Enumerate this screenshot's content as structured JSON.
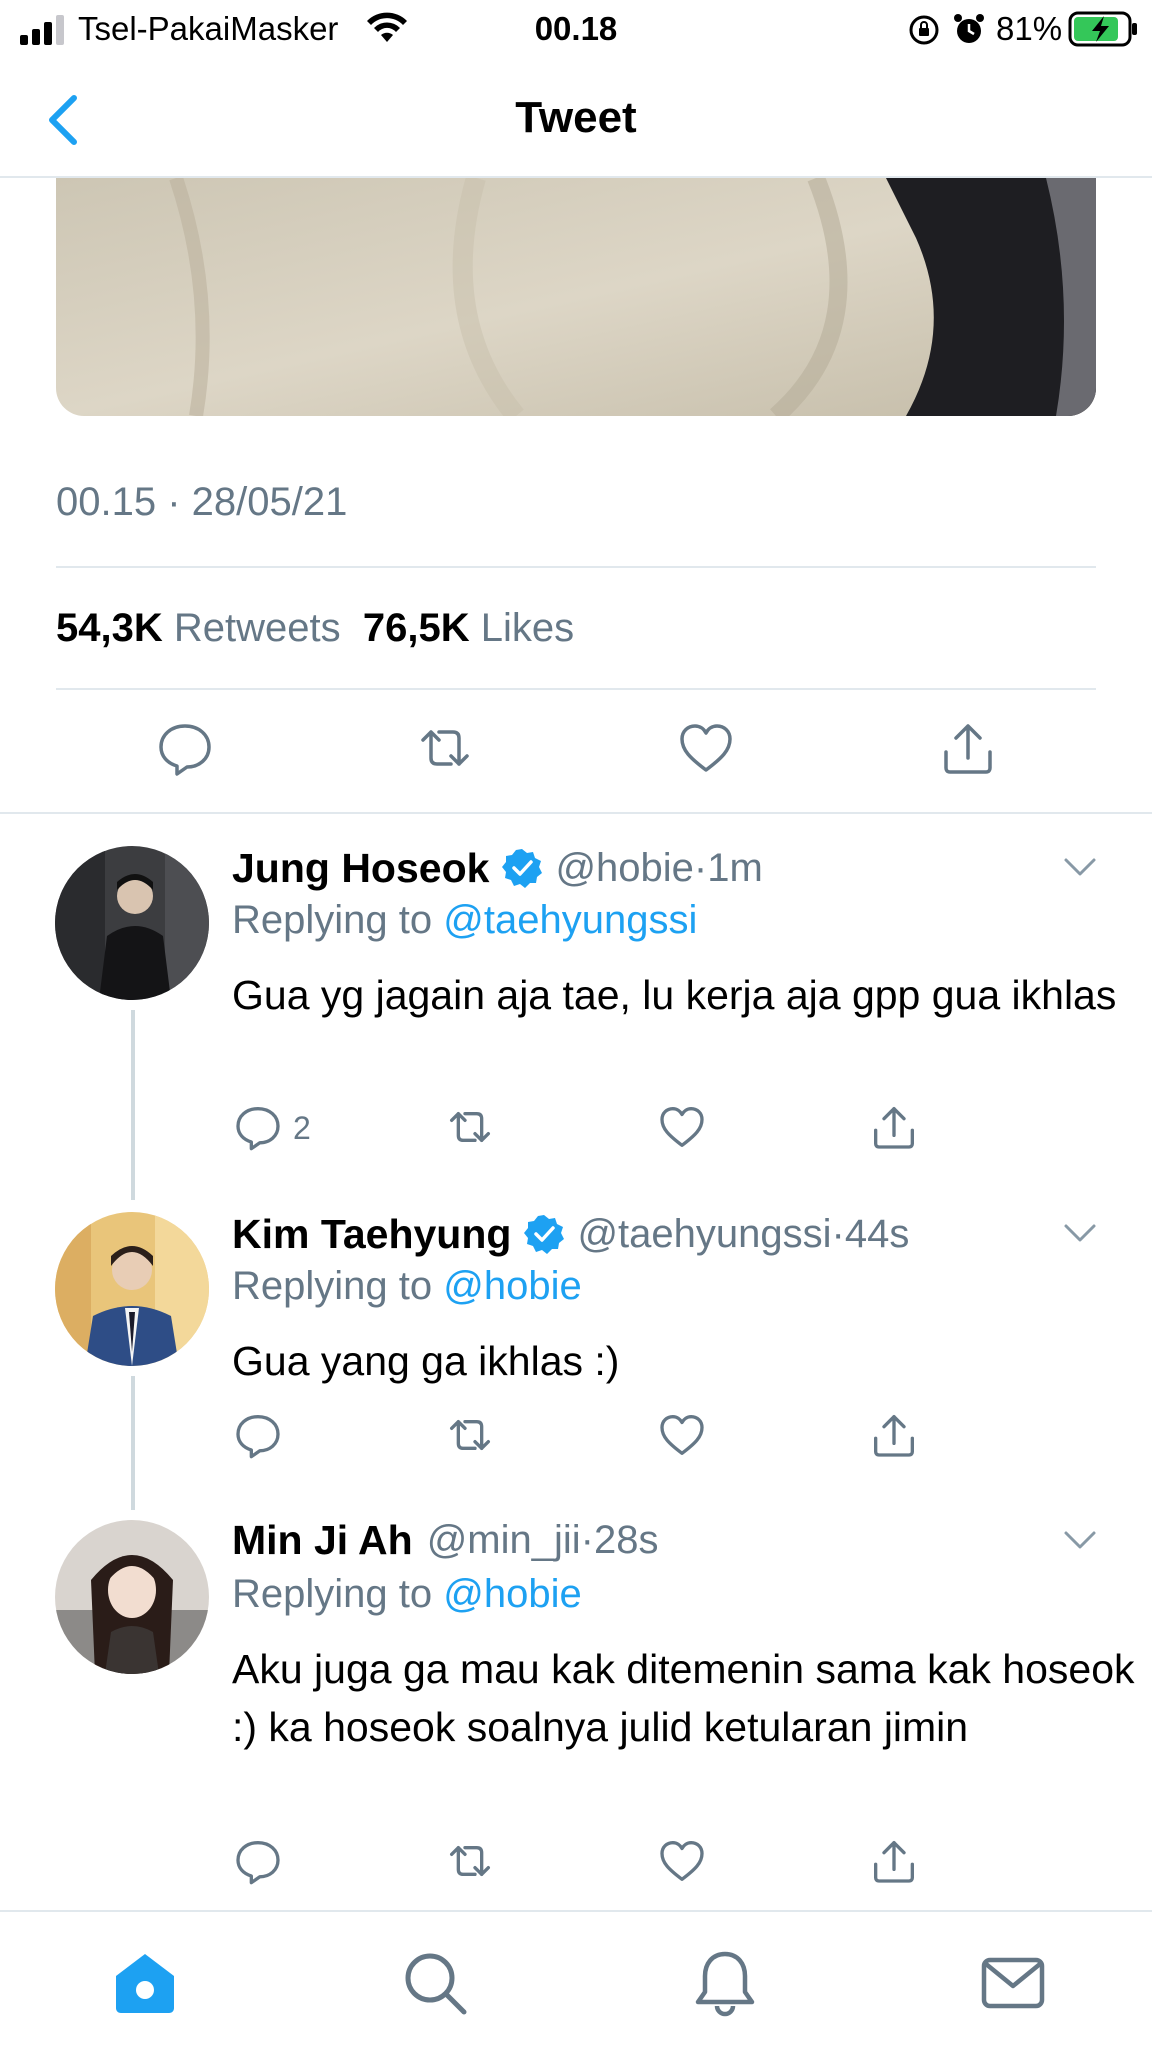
{
  "status_bar": {
    "carrier": "Tsel-PakaiMasker",
    "time": "00.18",
    "battery": "81%"
  },
  "nav": {
    "title": "Tweet"
  },
  "tweet": {
    "time": "00.15",
    "date": "28/05/21",
    "retweet_count": "54,3K",
    "retweet_label": "Retweets",
    "like_count": "76,5K",
    "like_label": "Likes"
  },
  "replies": [
    {
      "name": "Jung Hoseok",
      "verified": true,
      "handle": "@hobie",
      "age": "1m",
      "replying_label": "Replying to",
      "replying_to": "@taehyungssi",
      "text": "Gua yg jagain aja tae, lu kerja aja gpp gua ikhlas",
      "reply_count": "2"
    },
    {
      "name": "Kim Taehyung",
      "verified": true,
      "handle": "@taehyungssi",
      "age": "44s",
      "replying_label": "Replying to",
      "replying_to": "@hobie",
      "text": "Gua yang ga ikhlas :)"
    },
    {
      "name": "Min Ji Ah",
      "verified": false,
      "handle": "@min_jii",
      "age": "28s",
      "replying_label": "Replying to",
      "replying_to": "@hobie",
      "text": "Aku juga ga mau kak ditemenin sama kak hoseok :) ka hoseok soalnya julid ketularan jimin"
    }
  ],
  "colors": {
    "accent": "#1da1f2",
    "secondary_text": "#657786",
    "divider": "#e1e8ed"
  }
}
